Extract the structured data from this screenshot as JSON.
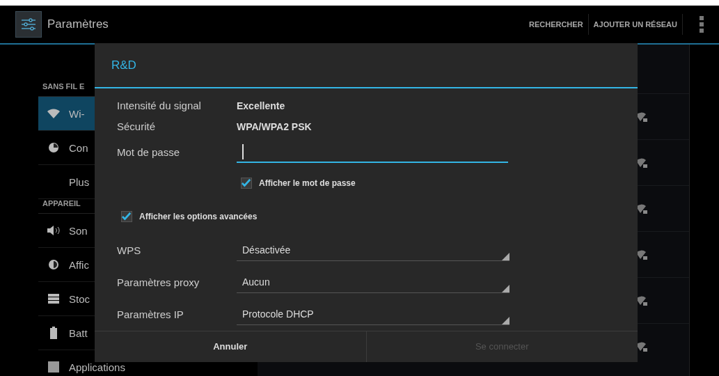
{
  "window": {
    "title": "Paramètres"
  },
  "actions": [
    {
      "label": "RECHERCHER"
    },
    {
      "label": "AJOUTER UN RÉSEAU"
    }
  ],
  "sidebar": {
    "sections": [
      {
        "header": "SANS FIL E",
        "items": [
          {
            "label": "Wi-",
            "kind": "wifi",
            "selected": true
          },
          {
            "label": "Con",
            "kind": "data",
            "selected": false
          },
          {
            "label": "Plus",
            "kind": "more",
            "selected": false
          }
        ]
      },
      {
        "header": "APPAREIL",
        "items": [
          {
            "label": "Son",
            "kind": "sound",
            "selected": false
          },
          {
            "label": "Affic",
            "kind": "display",
            "selected": false
          },
          {
            "label": "Stoc",
            "kind": "storage",
            "selected": false
          },
          {
            "label": "Batt",
            "kind": "battery",
            "selected": false
          },
          {
            "label": "Applications",
            "kind": "apps",
            "selected": false
          }
        ]
      }
    ]
  },
  "dialog": {
    "title": "R&D",
    "info": [
      {
        "label": "Intensité du signal",
        "value": "Excellente"
      },
      {
        "label": "Sécurité",
        "value": "WPA/WPA2 PSK"
      }
    ],
    "password": {
      "label": "Mot de passe"
    },
    "show_password": {
      "label": "Afficher le mot de passe",
      "checked": true
    },
    "advanced": {
      "label": "Afficher les options avancées",
      "checked": true
    },
    "spinners": [
      {
        "label": "WPS",
        "value": "Désactivée"
      },
      {
        "label": "Paramètres proxy",
        "value": "Aucun"
      },
      {
        "label": "Paramètres IP",
        "value": "Protocole DHCP"
      }
    ],
    "buttons": [
      {
        "label": "Annuler",
        "disabled": false
      },
      {
        "label": "Se connecter",
        "disabled": true
      }
    ]
  }
}
